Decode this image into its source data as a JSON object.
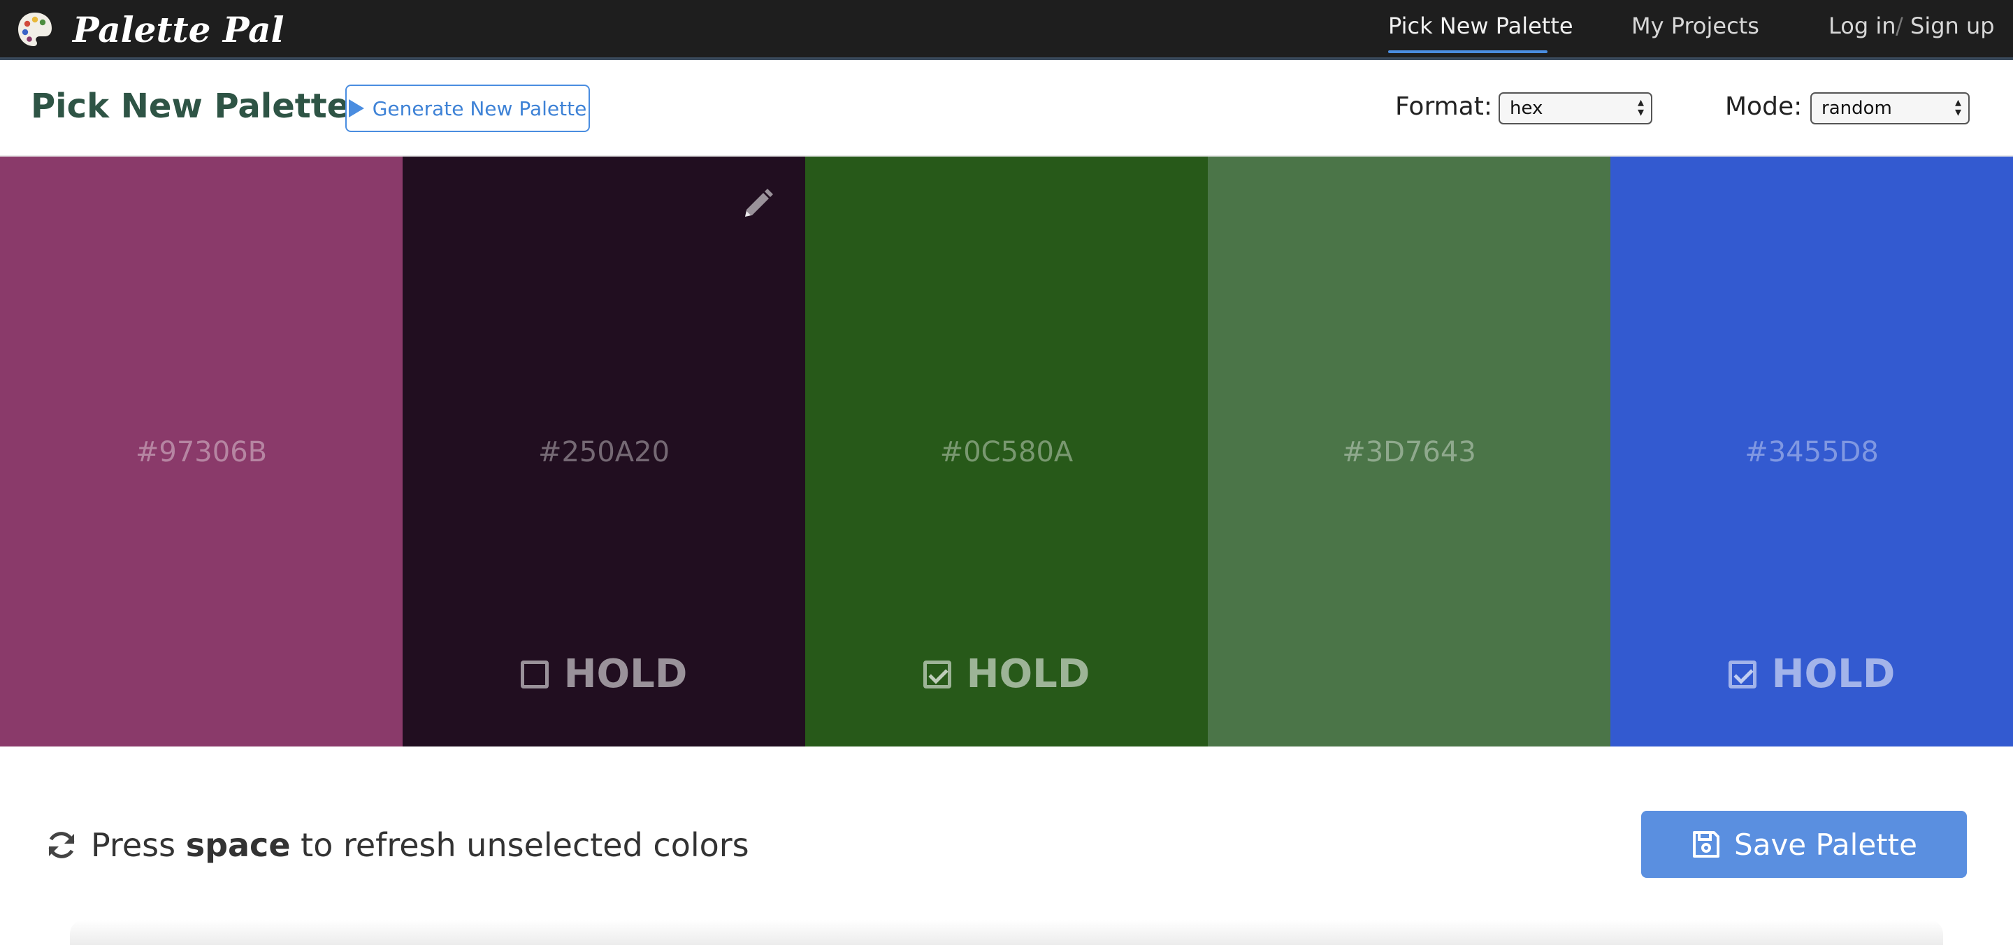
{
  "app": {
    "name": "Palette Pal"
  },
  "nav": {
    "pick_label": "Pick New Palette",
    "projects_label": "My Projects",
    "login_label": "Log in",
    "separator": "/",
    "signup_label": "Sign up"
  },
  "header": {
    "title": "Pick New Palette",
    "generate_label": "Generate New Palette",
    "format_label": "Format:",
    "format_value": "hex",
    "mode_label": "Mode:",
    "mode_value": "random"
  },
  "swatches": [
    {
      "hex": "#97306B",
      "color": "#8a3a6a",
      "hold_shown": false,
      "held": false
    },
    {
      "hex": "#250A20",
      "color": "#210e20",
      "hold_shown": true,
      "held": false,
      "hold_label": "HOLD"
    },
    {
      "hex": "#0C580A",
      "color": "#275919",
      "hold_shown": true,
      "held": true,
      "hold_label": "HOLD"
    },
    {
      "hex": "#3D7643",
      "color": "#4b7548",
      "hold_shown": false,
      "held": false
    },
    {
      "hex": "#3455D8",
      "color": "#335ad0",
      "hold_shown": true,
      "held": true,
      "hold_label": "HOLD"
    }
  ],
  "footer": {
    "hint_prefix": "Press",
    "hint_key": "space",
    "hint_suffix": "to refresh unselected colors",
    "save_label": "Save Palette"
  },
  "icons": {
    "brand": "palette-icon",
    "edit": "pencil-icon",
    "refresh": "refresh-icon",
    "save": "floppy-disk-icon"
  },
  "colors": {
    "nav_bg": "#1e1e1e",
    "accent": "#4a8de0",
    "title": "#2e5445",
    "save_bg": "#5a8fe0"
  }
}
